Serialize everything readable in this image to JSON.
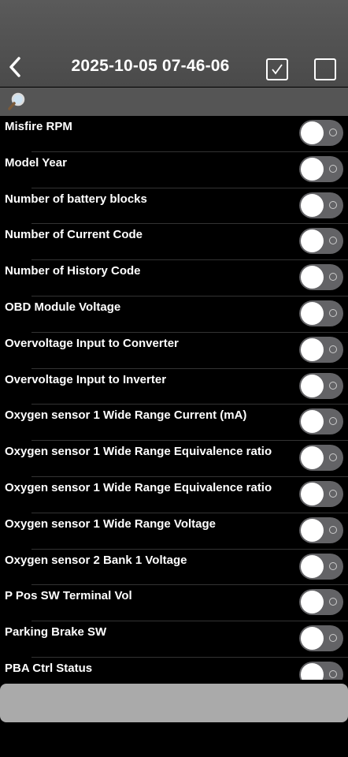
{
  "header": {
    "title": "2025-10-05 07-46-06",
    "back_icon": "chevron-left-icon",
    "select_all_icon": "checkbox-checked-icon",
    "deselect_icon": "checkbox-empty-icon"
  },
  "search": {
    "icon": "search-icon",
    "value": ""
  },
  "items": [
    {
      "label": "Misfire RPM",
      "on": false
    },
    {
      "label": "Model Year",
      "on": false
    },
    {
      "label": "Number of battery blocks",
      "on": false
    },
    {
      "label": "Number of Current Code",
      "on": false
    },
    {
      "label": "Number of History Code",
      "on": false
    },
    {
      "label": "OBD Module Voltage",
      "on": false
    },
    {
      "label": "Overvoltage Input to Converter",
      "on": false
    },
    {
      "label": "Overvoltage Input to Inverter",
      "on": false
    },
    {
      "label": "Oxygen sensor 1 Wide Range Current (mA)",
      "on": false
    },
    {
      "label": "Oxygen sensor 1 Wide Range Equivalence ratio",
      "on": false
    },
    {
      "label": "Oxygen sensor 1 Wide Range Equivalence ratio",
      "on": false
    },
    {
      "label": "Oxygen sensor 1 Wide Range Voltage",
      "on": false
    },
    {
      "label": "Oxygen sensor 2 Bank 1 Voltage",
      "on": false
    },
    {
      "label": "P Pos SW Terminal Vol",
      "on": false
    },
    {
      "label": "Parking Brake SW",
      "on": false
    },
    {
      "label": "PBA Ctrl Status",
      "on": false
    }
  ],
  "bottom_button": {
    "label": ""
  },
  "colors": {
    "header_bg": "#555555",
    "toggle_off": "#636366",
    "background": "#000000"
  }
}
